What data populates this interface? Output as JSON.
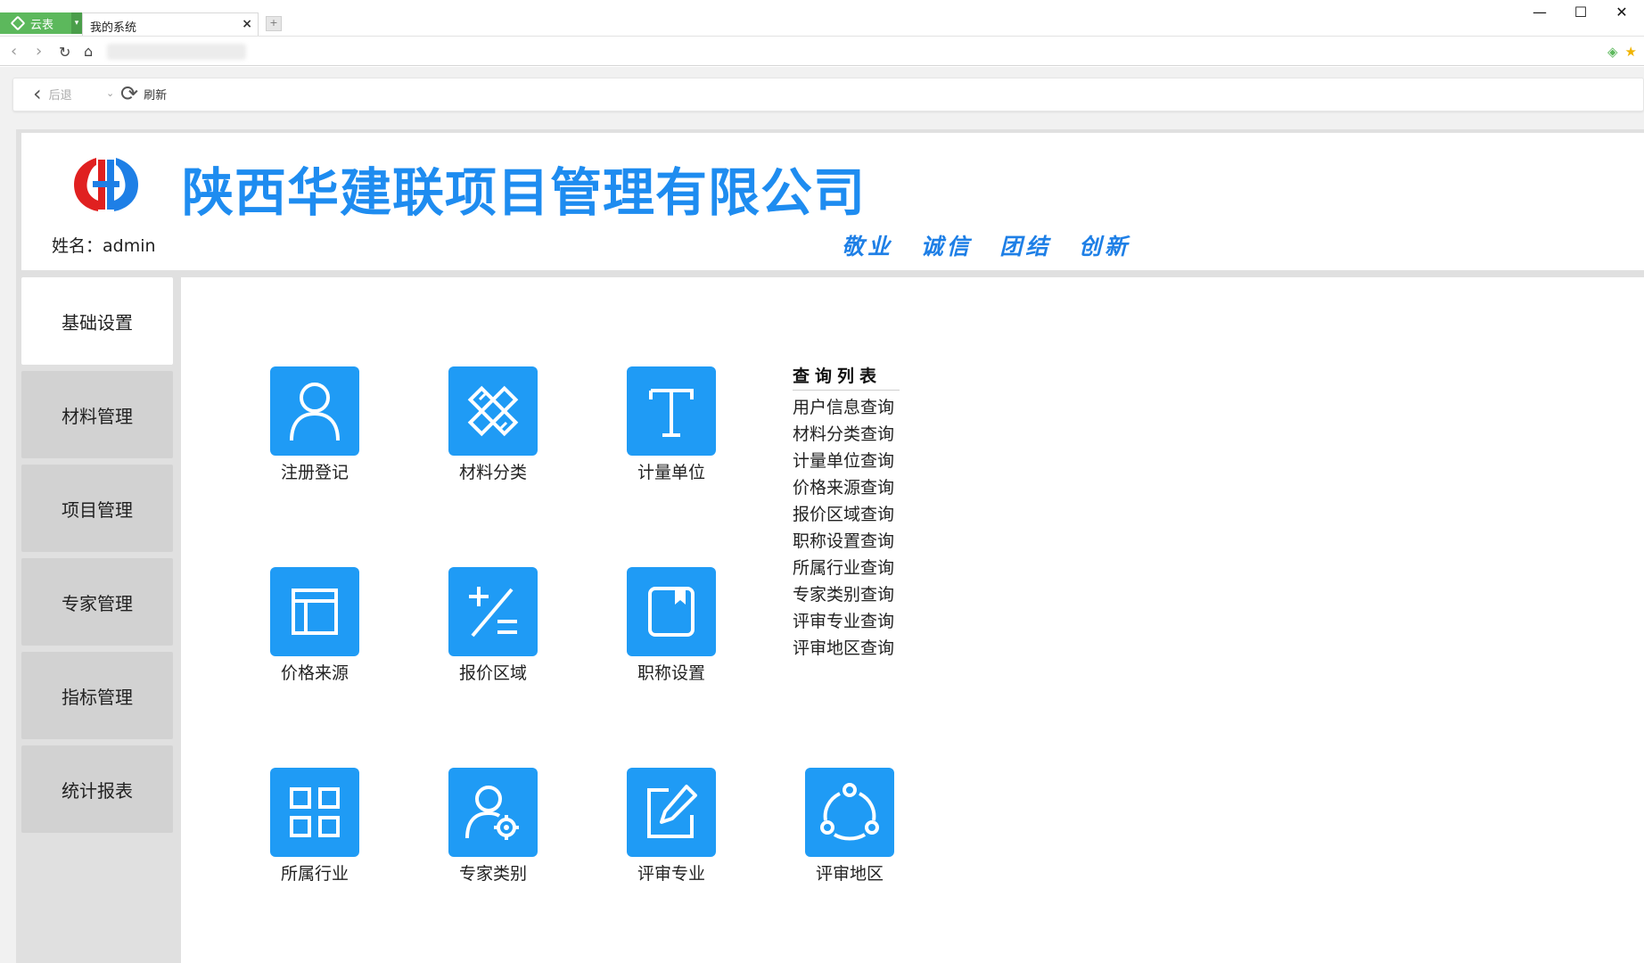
{
  "browser": {
    "app_name": "云表",
    "tab_title": "我的系统",
    "tab_close": "×",
    "new_tab": "+",
    "window_controls": {
      "minimize": "—",
      "maximize": "☐",
      "close": "✕"
    }
  },
  "toolbar": {
    "back_label": "后退",
    "refresh_label": "刷新"
  },
  "header": {
    "company_name": "陕西华建联项目管理有限公司",
    "user_label": "姓名：admin",
    "slogan": "敬业 诚信 团结 创新"
  },
  "colors": {
    "brand_blue": "#1e8cf0",
    "tile_blue": "#1f9bf5",
    "sidebar_gray": "#d2d2d2",
    "badge_green": "#5cb85c",
    "logo_red": "#e02020"
  },
  "sidebar": {
    "items": [
      {
        "label": "基础设置",
        "active": true
      },
      {
        "label": "材料管理",
        "active": false
      },
      {
        "label": "项目管理",
        "active": false
      },
      {
        "label": "专家管理",
        "active": false
      },
      {
        "label": "指标管理",
        "active": false
      },
      {
        "label": "统计报表",
        "active": false
      }
    ]
  },
  "tiles": [
    {
      "label": "注册登记",
      "icon": "user-icon"
    },
    {
      "label": "材料分类",
      "icon": "ruler-pencil-icon"
    },
    {
      "label": "计量单位",
      "icon": "text-t-icon"
    },
    {
      "label": "价格来源",
      "icon": "layout-icon"
    },
    {
      "label": "报价区域",
      "icon": "plus-minus-icon"
    },
    {
      "label": "职称设置",
      "icon": "bookmark-icon"
    },
    {
      "label": "所属行业",
      "icon": "grid-icon"
    },
    {
      "label": "专家类别",
      "icon": "user-gear-icon"
    },
    {
      "label": "评审专业",
      "icon": "edit-icon"
    },
    {
      "label": "评审地区",
      "icon": "share-nodes-icon"
    }
  ],
  "query_list": {
    "title": "查询列表",
    "items": [
      "用户信息查询",
      "材料分类查询",
      "计量单位查询",
      "价格来源查询",
      "报价区域查询",
      "职称设置查询",
      "所属行业查询",
      "专家类别查询",
      "评审专业查询",
      "评审地区查询"
    ]
  }
}
